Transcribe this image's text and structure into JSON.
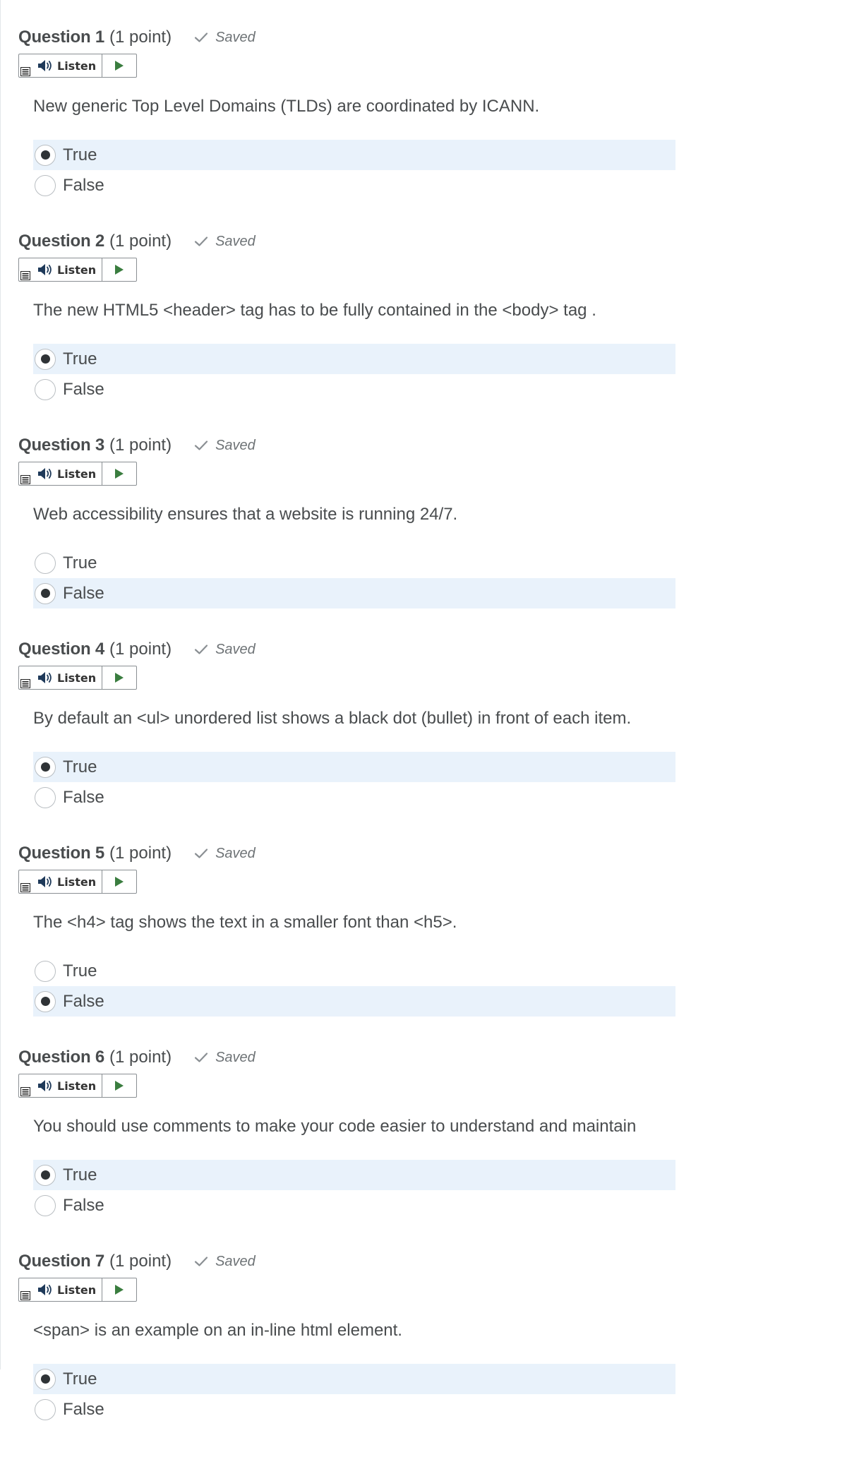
{
  "saved_label": "Saved",
  "listen_label": "Listen",
  "colors": {
    "selected_bg": "#e9f2fb",
    "text": "#494c4e",
    "play_green": "#3a7d3f"
  },
  "questions": [
    {
      "title": "Question 1",
      "points": "(1 point)",
      "text": "New generic Top Level Domains (TLDs) are coordinated by ICANN.",
      "options": [
        "True",
        "False"
      ],
      "selected": "True"
    },
    {
      "title": "Question 2",
      "points": "(1 point)",
      "text": "The new HTML5 <header> tag has to be fully contained in the <body> tag .",
      "options": [
        "True",
        "False"
      ],
      "selected": "True"
    },
    {
      "title": "Question 3",
      "points": "(1 point)",
      "text": "Web accessibility ensures that a website is running 24/7.",
      "options": [
        "True",
        "False"
      ],
      "selected": "False"
    },
    {
      "title": "Question 4",
      "points": "(1 point)",
      "text": "By default an <ul> unordered list shows a black dot (bullet) in front of each item.",
      "options": [
        "True",
        "False"
      ],
      "selected": "True"
    },
    {
      "title": "Question 5",
      "points": "(1 point)",
      "text": "The <h4> tag shows the text in a smaller font than <h5>.",
      "options": [
        "True",
        "False"
      ],
      "selected": "False"
    },
    {
      "title": "Question 6",
      "points": "(1 point)",
      "text": "You should use comments to make your code easier to understand and maintain",
      "options": [
        "True",
        "False"
      ],
      "selected": "True"
    },
    {
      "title": "Question 7",
      "points": "(1 point)",
      "text": "<span> is an example on an in-line html element.",
      "options": [
        "True",
        "False"
      ],
      "selected": "True"
    }
  ]
}
